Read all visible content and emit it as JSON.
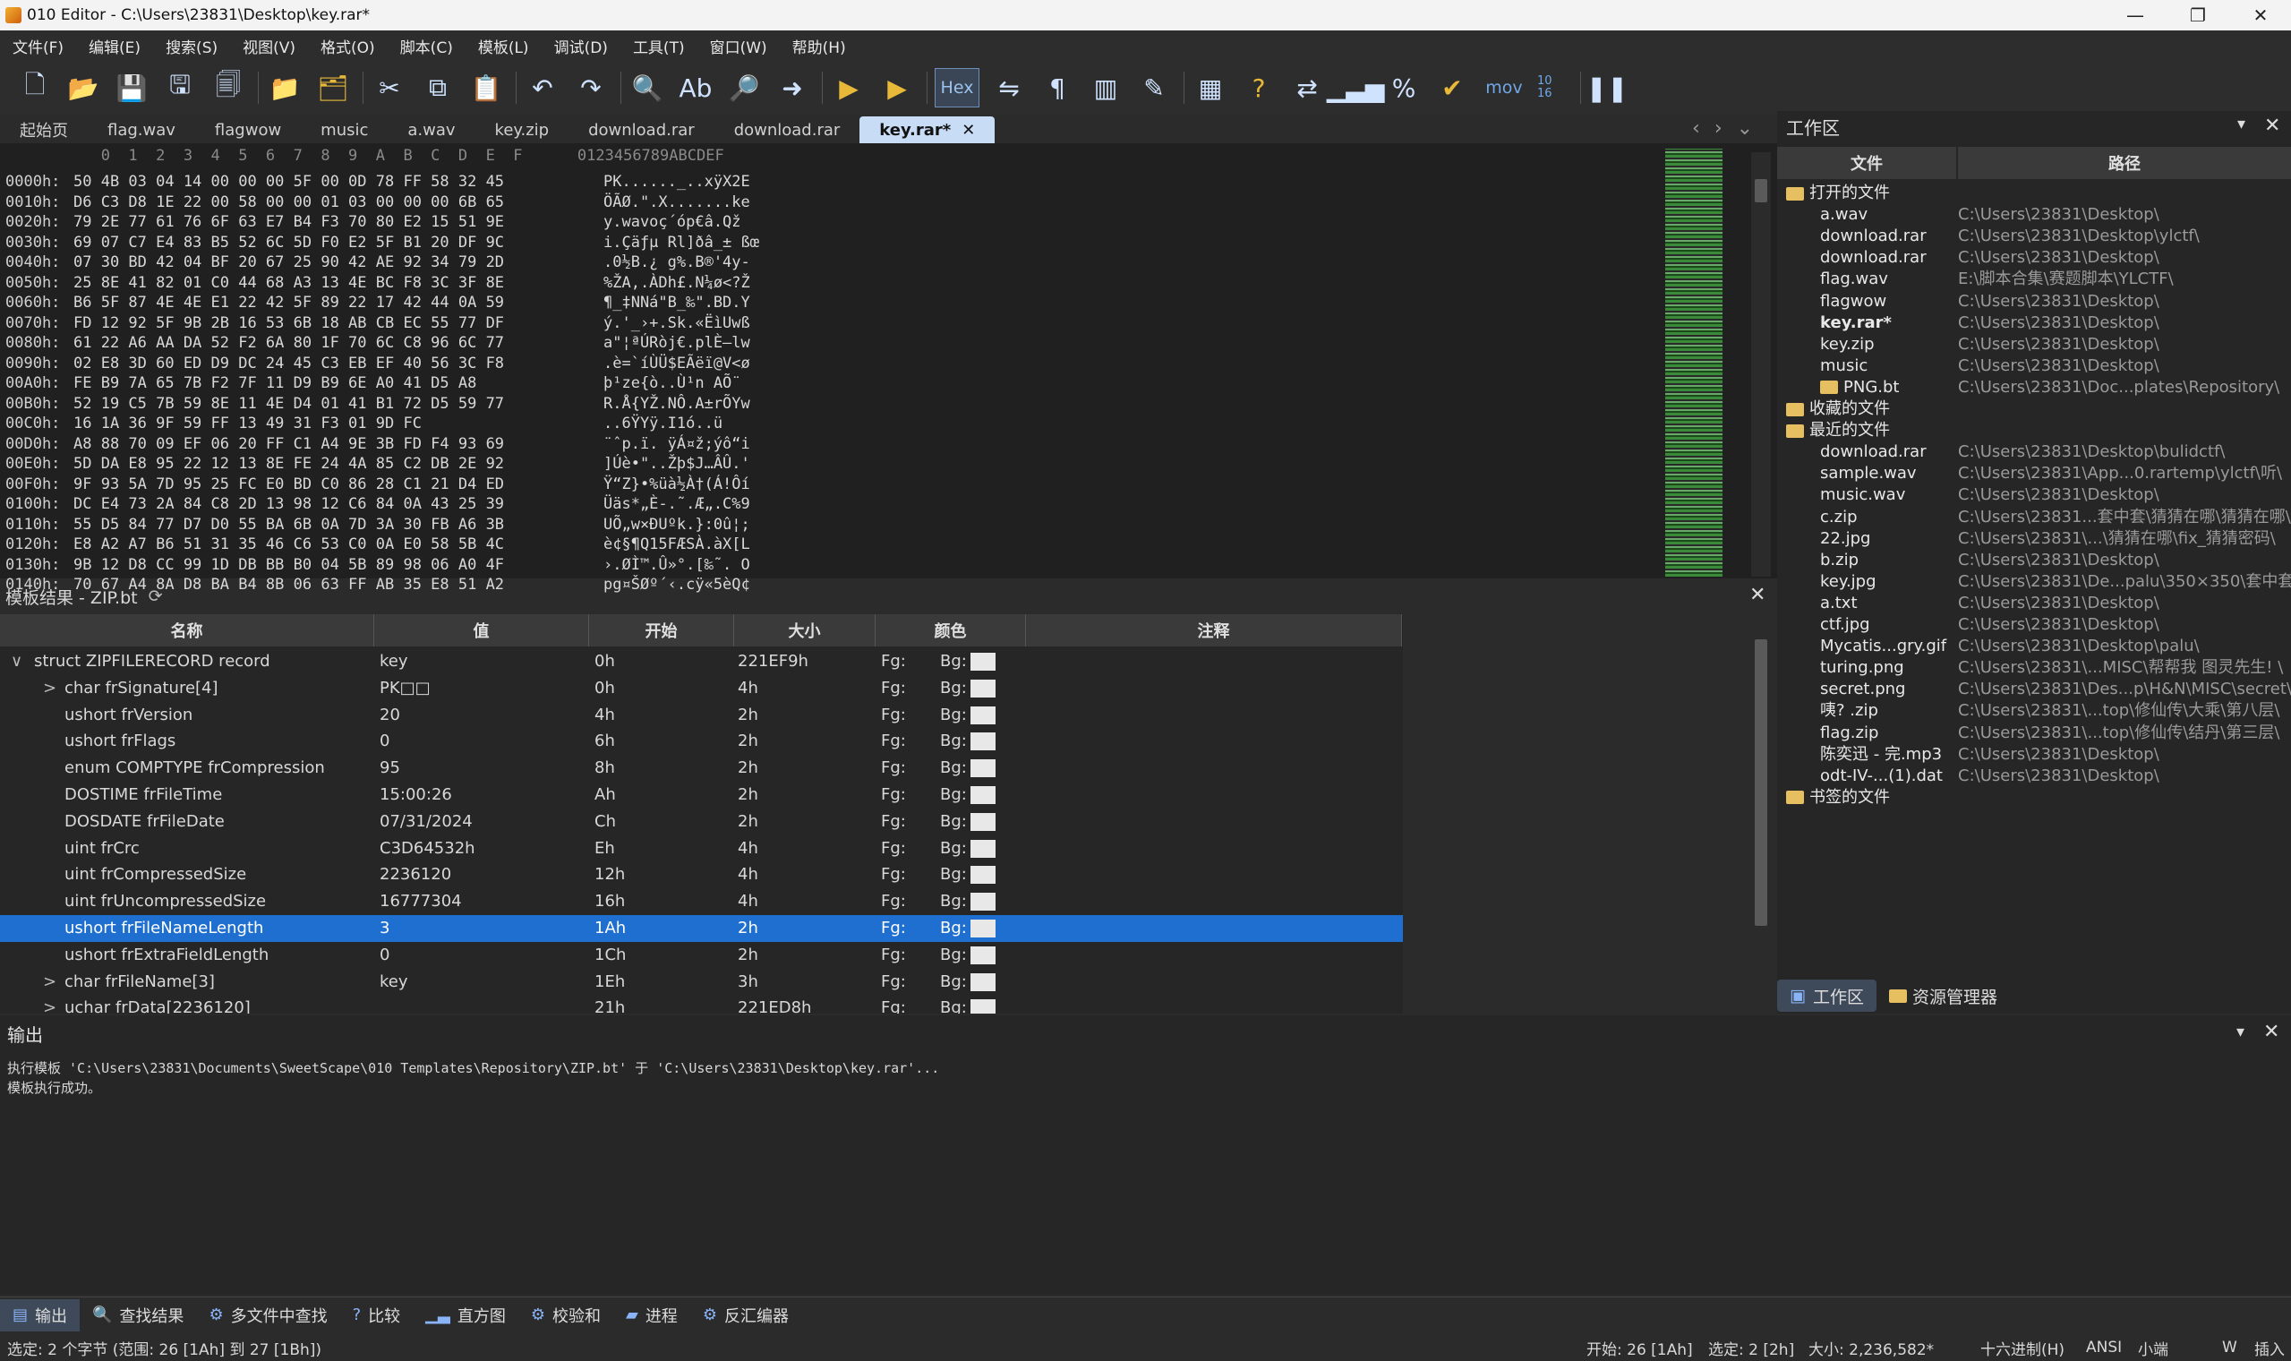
{
  "window": {
    "title": "010 Editor - C:\\Users\\23831\\Desktop\\key.rar*",
    "min": "—",
    "max": "❐",
    "close": "✕"
  },
  "menu": [
    "文件(F)",
    "编辑(E)",
    "搜索(S)",
    "视图(V)",
    "格式(O)",
    "脚本(C)",
    "模板(L)",
    "调试(D)",
    "工具(T)",
    "窗口(W)",
    "帮助(H)"
  ],
  "toolbar": {
    "hex_label": "Hex",
    "mov_label": "mov",
    "base_label": "10 16",
    "icons": [
      "new-file-icon",
      "open-icon",
      "save-icon",
      "save-as-icon",
      "save-all-icon",
      "open-folder-icon",
      "workspace-icon",
      "cut-icon",
      "copy-icon",
      "paste-icon",
      "undo-icon",
      "redo-icon",
      "find-icon",
      "replace-icon",
      "find-in-files-icon",
      "goto-icon",
      "run-script-icon",
      "run-template-icon",
      "hex-icon",
      "compare-icon",
      "pilcrow-icon",
      "columns-icon",
      "highlight-icon",
      "calculator-icon",
      "inspector-icon",
      "swap-icon",
      "histogram-icon",
      "percent-icon",
      "checksum-icon",
      "mov-icon",
      "base-convert-icon",
      "pause-icon"
    ]
  },
  "tabs": [
    {
      "label": "起始页"
    },
    {
      "label": "flag.wav"
    },
    {
      "label": "flagwow"
    },
    {
      "label": "music"
    },
    {
      "label": "a.wav"
    },
    {
      "label": "key.zip"
    },
    {
      "label": "download.rar"
    },
    {
      "label": "download.rar"
    },
    {
      "label": "key.rar*",
      "active": true
    }
  ],
  "hex": {
    "header": "   0  1  2  3  4  5  6  7  8  9  A  B  C  D  E  F      0123456789ABCDEF",
    "rows": [
      {
        "addr": "0000h:",
        "bytes": "50 4B 03 04 14 00 00 00 5F 00 0D 78 FF 58 32 45",
        "ascii": "PK......_..xÿX2E"
      },
      {
        "addr": "0010h:",
        "bytes": "D6 C3 D8 1E 22 00 58 00 00 01 03 00 00 00 6B 65",
        "ascii": "ÖÃØ.\".X.......ke"
      },
      {
        "addr": "0020h:",
        "bytes": "79 2E 77 61 76 6F 63 E7 B4 F3 70 80 E2 15 51 9E",
        "ascii": "y.wavoç´óp€â.Qž"
      },
      {
        "addr": "0030h:",
        "bytes": "69 07 C7 E4 83 B5 52 6C 5D F0 E2 5F B1 20 DF 9C",
        "ascii": "i.Çäƒµ Rl]ðâ_± ßœ"
      },
      {
        "addr": "0040h:",
        "bytes": "07 30 BD 42 04 BF 20 67 25 90 42 AE 92 34 79 2D",
        "ascii": ".0½B.¿ g%.B®'4y-"
      },
      {
        "addr": "0050h:",
        "bytes": "25 8E 41 82 01 C0 44 68 A3 13 4E BC F8 3C 3F 8E",
        "ascii": "%ŽA‚.ÀDh£.N¼ø<?Ž"
      },
      {
        "addr": "0060h:",
        "bytes": "B6 5F 87 4E 4E E1 22 42 5F 89 22 17 42 44 0A 59",
        "ascii": "¶_‡NNá\"B_‰\".BD.Y"
      },
      {
        "addr": "0070h:",
        "bytes": "FD 12 92 5F 9B 2B 16 53 6B 18 AB CB EC 55 77 DF",
        "ascii": "ý.'_›+.Sk.«ËìUwß"
      },
      {
        "addr": "0080h:",
        "bytes": "61 22 A6 AA DA 52 F2 6A 80 1F 70 6C C8 96 6C 77",
        "ascii": "a\"¦ªÚRòj€.plÈ–lw"
      },
      {
        "addr": "0090h:",
        "bytes": "02 E8 3D 60 ED D9 DC 24 45 C3 EB EF 40 56 3C F8",
        "ascii": ".è=`íÙÜ$EÃëï@V<ø"
      },
      {
        "addr": "00A0h:",
        "bytes": "FE B9 7A 65 7B F2 7F 11 D9 B9 6E A0 41 D5 A8",
        "ascii": "þ¹ze{ò..Ù¹n AÕ¨"
      },
      {
        "addr": "00B0h:",
        "bytes": "52 19 C5 7B 59 8E 11 4E D4 01 41 B1 72 D5 59 77",
        "ascii": "R.Å{YŽ.NÔ.A±rÕYw"
      },
      {
        "addr": "00C0h:",
        "bytes": "16 1A 36 9F 59 FF 13 49 31 F3 01 9D FC",
        "ascii": "..6ŸYÿ.I1ó..ü"
      },
      {
        "addr": "00D0h:",
        "bytes": "A8 88 70 09 EF 06 20 FF C1 A4 9E 3B FD F4 93 69",
        "ascii": "¨ˆp.ï. ÿÁ¤ž;ýô“i"
      },
      {
        "addr": "00E0h:",
        "bytes": "5D DA E8 95 22 12 13 8E FE 24 4A 85 C2 DB 2E 92",
        "ascii": "]Úè•\"..Žþ$J…ÂÛ.'"
      },
      {
        "addr": "00F0h:",
        "bytes": "9F 93 5A 7D 95 25 FC E0 BD C0 86 28 C1 21 D4 ED",
        "ascii": "Ÿ“Z}•%üà½À†(Á!Ôí"
      },
      {
        "addr": "0100h:",
        "bytes": "DC E4 73 2A 84 C8 2D 13 98 12 C6 84 0A 43 25 39",
        "ascii": "Üäs*„È-.˜.Æ„.C%9"
      },
      {
        "addr": "0110h:",
        "bytes": "55 D5 84 77 D7 D0 55 BA 6B 0A 7D 3A 30 FB A6 3B",
        "ascii": "UÕ„w×ÐUºk.}:0û¦;"
      },
      {
        "addr": "0120h:",
        "bytes": "E8 A2 A7 B6 51 31 35 46 C6 53 C0 0A E0 58 5B 4C",
        "ascii": "è¢§¶Q15FÆSÀ.àX[L"
      },
      {
        "addr": "0130h:",
        "bytes": "9B 12 D8 CC 99 1D DB BB B0 04 5B 89 98 06 A0 4F",
        "ascii": "›.ØÌ™.Û»°.[‰˜. O"
      },
      {
        "addr": "0140h:",
        "bytes": "70 67 A4 8A D8 BA B4 8B 06 63 FF AB 35 E8 51 A2",
        "ascii": "pg¤ŠØº´‹.cÿ«5èQ¢"
      }
    ]
  },
  "template_panel": {
    "title": "模板结果 - ZIP.bt",
    "close": "✕",
    "columns": {
      "name": "名称",
      "value": "值",
      "start": "开始",
      "size": "大小",
      "color": "颜色",
      "comment": "注释"
    },
    "rows": [
      {
        "name": "struct ZIPFILERECORD record",
        "value": "key",
        "start": "0h",
        "size": "221EF9h",
        "fg": "Fg:",
        "bg": "Bg:",
        "expand": "∨",
        "indent": 0
      },
      {
        "name": "char frSignature[4]",
        "value": "PK□□",
        "start": "0h",
        "size": "4h",
        "fg": "Fg:",
        "bg": "Bg:",
        "expand": ">",
        "indent": 1
      },
      {
        "name": "ushort frVersion",
        "value": "20",
        "start": "4h",
        "size": "2h",
        "fg": "Fg:",
        "bg": "Bg:",
        "expand": "",
        "indent": 1
      },
      {
        "name": "ushort frFlags",
        "value": "0",
        "start": "6h",
        "size": "2h",
        "fg": "Fg:",
        "bg": "Bg:",
        "expand": "",
        "indent": 1
      },
      {
        "name": "enum COMPTYPE frCompression",
        "value": "95",
        "start": "8h",
        "size": "2h",
        "fg": "Fg:",
        "bg": "Bg:",
        "expand": "",
        "indent": 1
      },
      {
        "name": "DOSTIME frFileTime",
        "value": "15:00:26",
        "start": "Ah",
        "size": "2h",
        "fg": "Fg:",
        "bg": "Bg:",
        "expand": "",
        "indent": 1
      },
      {
        "name": "DOSDATE frFileDate",
        "value": "07/31/2024",
        "start": "Ch",
        "size": "2h",
        "fg": "Fg:",
        "bg": "Bg:",
        "expand": "",
        "indent": 1
      },
      {
        "name": "uint frCrc",
        "value": "C3D64532h",
        "start": "Eh",
        "size": "4h",
        "fg": "Fg:",
        "bg": "Bg:",
        "expand": "",
        "indent": 1
      },
      {
        "name": "uint frCompressedSize",
        "value": "2236120",
        "start": "12h",
        "size": "4h",
        "fg": "Fg:",
        "bg": "Bg:",
        "expand": "",
        "indent": 1
      },
      {
        "name": "uint frUncompressedSize",
        "value": "16777304",
        "start": "16h",
        "size": "4h",
        "fg": "Fg:",
        "bg": "Bg:",
        "expand": "",
        "indent": 1
      },
      {
        "name": "ushort frFileNameLength",
        "value": "3",
        "start": "1Ah",
        "size": "2h",
        "fg": "Fg:",
        "bg": "Bg:",
        "expand": "",
        "indent": 1,
        "selected": true
      },
      {
        "name": "ushort frExtraFieldLength",
        "value": "0",
        "start": "1Ch",
        "size": "2h",
        "fg": "Fg:",
        "bg": "Bg:",
        "expand": "",
        "indent": 1
      },
      {
        "name": "char frFileName[3]",
        "value": "key",
        "start": "1Eh",
        "size": "3h",
        "fg": "Fg:",
        "bg": "Bg:",
        "expand": ">",
        "indent": 1
      },
      {
        "name": "uchar frData[2236120]",
        "value": "",
        "start": "21h",
        "size": "221ED8h",
        "fg": "Fg:",
        "bg": "Bg:",
        "expand": ">",
        "indent": 1
      }
    ]
  },
  "workspace": {
    "title": "工作区",
    "pin": "▾",
    "close": "✕",
    "columns": {
      "file": "文件",
      "path": "路径"
    },
    "rows": [
      {
        "name": "打开的文件",
        "path": "",
        "folder": true,
        "indent": 0
      },
      {
        "name": "a.wav",
        "path": "C:\\Users\\23831\\Desktop\\",
        "indent": 1
      },
      {
        "name": "download.rar",
        "path": "C:\\Users\\23831\\Desktop\\ylctf\\",
        "indent": 1
      },
      {
        "name": "download.rar",
        "path": "C:\\Users\\23831\\Desktop\\",
        "indent": 1
      },
      {
        "name": "flag.wav",
        "path": "E:\\脚本合集\\赛题脚本\\YLCTF\\",
        "indent": 1
      },
      {
        "name": "flagwow",
        "path": "C:\\Users\\23831\\Desktop\\",
        "indent": 1
      },
      {
        "name": "key.rar*",
        "path": "C:\\Users\\23831\\Desktop\\",
        "indent": 1,
        "bold": true
      },
      {
        "name": "key.zip",
        "path": "C:\\Users\\23831\\Desktop\\",
        "indent": 1
      },
      {
        "name": "music",
        "path": "C:\\Users\\23831\\Desktop\\",
        "indent": 1
      },
      {
        "name": "PNG.bt",
        "path": "C:\\Users\\23831\\Doc...plates\\Repository\\",
        "indent": 1,
        "folder": true
      },
      {
        "name": "收藏的文件",
        "path": "",
        "folder": true,
        "indent": 0
      },
      {
        "name": "最近的文件",
        "path": "",
        "folder": true,
        "indent": 0
      },
      {
        "name": "download.rar",
        "path": "C:\\Users\\23831\\Desktop\\bulidctf\\",
        "indent": 1
      },
      {
        "name": "sample.wav",
        "path": "C:\\Users\\23831\\App...0.rartemp\\ylctf\\听\\",
        "indent": 1
      },
      {
        "name": "music.wav",
        "path": "C:\\Users\\23831\\Desktop\\",
        "indent": 1
      },
      {
        "name": "c.zip",
        "path": "C:\\Users\\23831...套中套\\猜猜在哪\\猜猜在哪\\",
        "indent": 1
      },
      {
        "name": "22.jpg",
        "path": "C:\\Users\\23831\\...\\猜猜在哪\\fix_猜猜密码\\",
        "indent": 1
      },
      {
        "name": "b.zip",
        "path": "C:\\Users\\23831\\Desktop\\",
        "indent": 1
      },
      {
        "name": "key.jpg",
        "path": "C:\\Users\\23831\\De...palu\\350×350\\套中套\\",
        "indent": 1
      },
      {
        "name": "a.txt",
        "path": "C:\\Users\\23831\\Desktop\\",
        "indent": 1
      },
      {
        "name": "ctf.jpg",
        "path": "C:\\Users\\23831\\Desktop\\",
        "indent": 1
      },
      {
        "name": "Mycatis...gry.gif",
        "path": "C:\\Users\\23831\\Desktop\\palu\\",
        "indent": 1
      },
      {
        "name": "turing.png",
        "path": "C:\\Users\\23831\\...MISC\\帮帮我 图灵先生! \\",
        "indent": 1
      },
      {
        "name": "secret.png",
        "path": "C:\\Users\\23831\\Des...p\\H&N\\MISC\\secret\\",
        "indent": 1
      },
      {
        "name": "咦? .zip",
        "path": "C:\\Users\\23831\\...top\\修仙传\\大乘\\第八层\\",
        "indent": 1
      },
      {
        "name": "flag.zip",
        "path": "C:\\Users\\23831\\...top\\修仙传\\结丹\\第三层\\",
        "indent": 1
      },
      {
        "name": "陈奕迅 - 完.mp3",
        "path": "C:\\Users\\23831\\Desktop\\",
        "indent": 1
      },
      {
        "name": "odt-IV-...(1).dat",
        "path": "C:\\Users\\23831\\Desktop\\",
        "indent": 1
      },
      {
        "name": "书签的文件",
        "path": "",
        "folder": true,
        "indent": 0
      }
    ],
    "tabs": [
      "工作区",
      "资源管理器"
    ]
  },
  "output": {
    "title": "输出",
    "lines": [
      "执行模板 'C:\\Users\\23831\\Documents\\SweetScape\\010 Templates\\Repository\\ZIP.bt' 于 'C:\\Users\\23831\\Desktop\\key.rar'...",
      "模板执行成功。"
    ]
  },
  "bottom_tabs": [
    "输出",
    "查找结果",
    "多文件中查找",
    "比较",
    "直方图",
    "校验和",
    "进程",
    "反汇编器"
  ],
  "status": {
    "selection": "选定: 2 个字节 (范围: 26 [1Ah] 到 27 [1Bh])",
    "start": "开始: 26 [1Ah]",
    "sel": "选定: 2 [2h]",
    "size": "大小: 2,236,582*",
    "mode": "十六进制(H)",
    "enc": "ANSI",
    "endian": "小端",
    "w": "W",
    "ins": "插入"
  }
}
